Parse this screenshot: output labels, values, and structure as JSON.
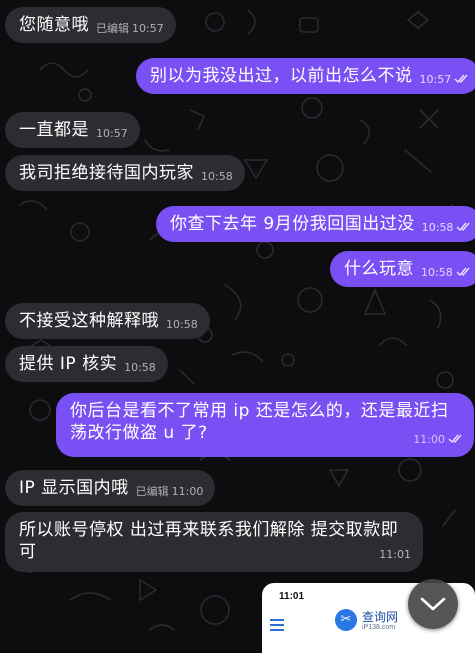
{
  "messages": [
    {
      "dir": "in",
      "text": "您随意哦",
      "edited": "已编辑",
      "time": "10:57"
    },
    {
      "dir": "out",
      "text": "别以为我没出过，以前出怎么不说",
      "time": "10:57"
    },
    {
      "dir": "in",
      "text": "一直都是",
      "time": "10:57"
    },
    {
      "dir": "in",
      "text": "我司拒绝接待国内玩家",
      "time": "10:58"
    },
    {
      "dir": "out",
      "text": "你查下去年 9月份我回国出过没",
      "time": "10:58"
    },
    {
      "dir": "out",
      "text": "什么玩意",
      "time": "10:58"
    },
    {
      "dir": "in",
      "text": "不接受这种解释哦",
      "time": "10:58"
    },
    {
      "dir": "in",
      "text": "提供 IP 核实",
      "time": "10:58"
    },
    {
      "dir": "out",
      "text": "你后台是看不了常用 ip 还是怎么的，还是最近扫荡改行做盗 u 了?",
      "time": "11:00"
    },
    {
      "dir": "in",
      "text": "IP 显示国内哦",
      "edited": "已编辑",
      "time": "11:00"
    },
    {
      "dir": "in",
      "text": "所以账号停权  出过再来联系我们解除  提交取款即可",
      "time": "11:01"
    }
  ],
  "popup": {
    "time": "11:01",
    "site_name": "查询网",
    "site_domain": "iP138.com",
    "logo_glyph": "✂"
  },
  "icons": {
    "read_check": "double-check-icon",
    "scroll_down": "chevron-down-icon",
    "menu": "hamburger-menu-icon"
  },
  "colors": {
    "outgoing_bubble": "#7a50f5",
    "incoming_bubble": "#2e2b31",
    "background": "#0d0d10"
  }
}
